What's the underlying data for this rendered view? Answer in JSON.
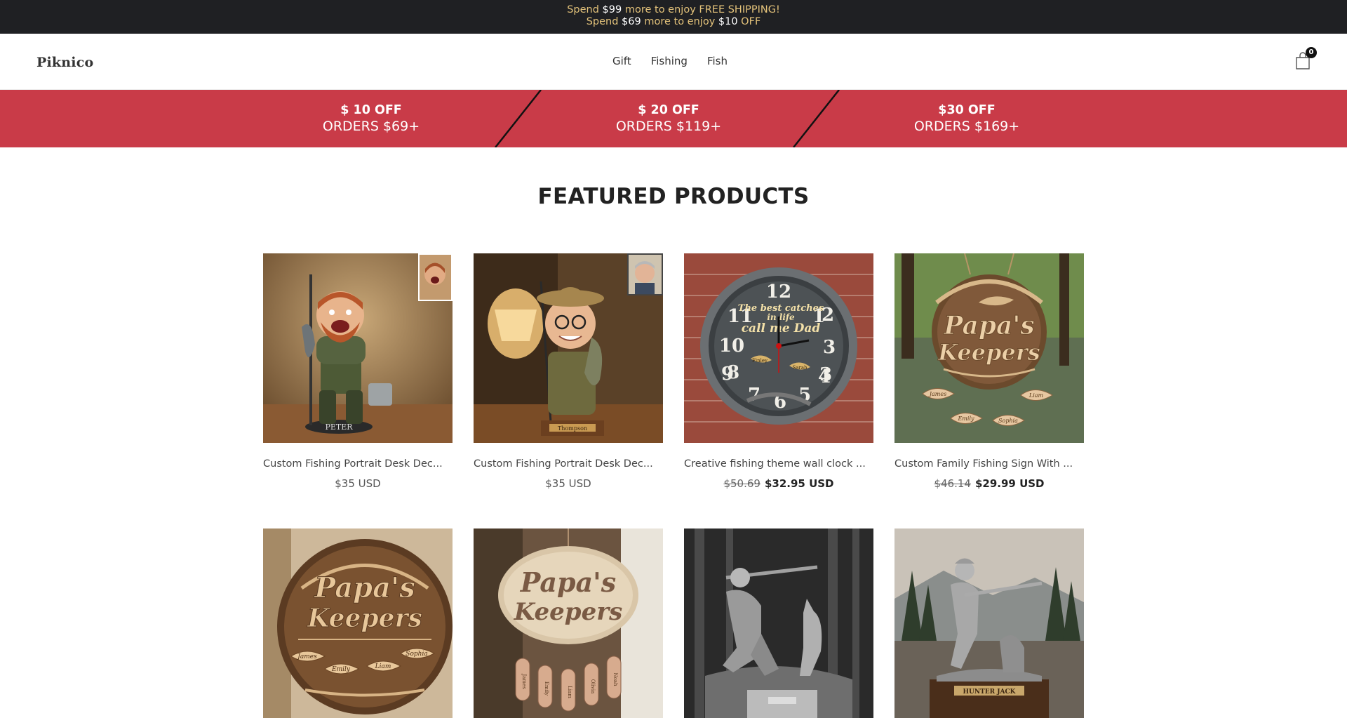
{
  "announcement": {
    "line1": {
      "pre": "Spend ",
      "amount": "$99",
      "post": " more to enjoy FREE SHIPPING!"
    },
    "line2": {
      "pre": "Spend ",
      "amount": "$69",
      "mid": " more to enjoy ",
      "discount": "$10",
      "post": " OFF"
    }
  },
  "header": {
    "logo": "Piknico",
    "nav": [
      "Gift",
      "Fishing",
      "Fish"
    ],
    "cart_count": "0"
  },
  "promo": [
    {
      "line1": "$ 10 OFF",
      "line2": "ORDERS $69+"
    },
    {
      "line1": "$ 20 OFF",
      "line2": "ORDERS $119+"
    },
    {
      "line1": "$30 OFF",
      "line2": "ORDERS $169+"
    }
  ],
  "featured": {
    "title": "FEATURED PRODUCTS",
    "products": [
      {
        "title": "Custom Fishing Portrait Desk Dec...",
        "price": "$35 USD",
        "old_price": "",
        "image": "fisherman-figurine",
        "plaque": "PETER"
      },
      {
        "title": "Custom Fishing Portrait Desk Dec...",
        "price": "$35 USD",
        "old_price": "",
        "image": "fisherman-bobblehead",
        "plaque": "Thompson"
      },
      {
        "title": "Creative fishing theme wall clock ...",
        "price": "$32.95 USD",
        "old_price": "$50.69",
        "image": "fishing-wall-clock",
        "clock_text": [
          "The best catches",
          "in life",
          "call me Dad"
        ],
        "clock_names": [
          "Finley",
          "Sarah"
        ]
      },
      {
        "title": "Custom Family Fishing Sign With ...",
        "price": "$29.99 USD",
        "old_price": "$46.14",
        "image": "papas-keepers-sign",
        "sign_text": [
          "Papa's",
          "Keepers"
        ],
        "names": [
          "James",
          "Liam",
          "Emily",
          "Sophia"
        ]
      },
      {
        "title": "",
        "price": "",
        "old_price": "",
        "image": "papas-keepers-round-sign",
        "sign_text": [
          "Papa's",
          "Keepers"
        ],
        "names": [
          "James",
          "Emily",
          "Liam",
          "Sophia"
        ]
      },
      {
        "title": "",
        "price": "",
        "old_price": "",
        "image": "papas-keepers-oval-sign",
        "sign_text": [
          "Papa's",
          "Keepers"
        ],
        "names": [
          "James",
          "Emily",
          "Liam",
          "Olivia",
          "Noah"
        ]
      },
      {
        "title": "",
        "price": "",
        "old_price": "",
        "image": "hunter-statue-dog",
        "plaque": ""
      },
      {
        "title": "",
        "price": "",
        "old_price": "",
        "image": "hunter-statue-kneeling",
        "plaque": "HUNTER JACK"
      }
    ]
  },
  "colors": {
    "announce_bg": "#1f2023",
    "announce_text": "#e3c27a",
    "promo_bg": "#c93b48"
  }
}
